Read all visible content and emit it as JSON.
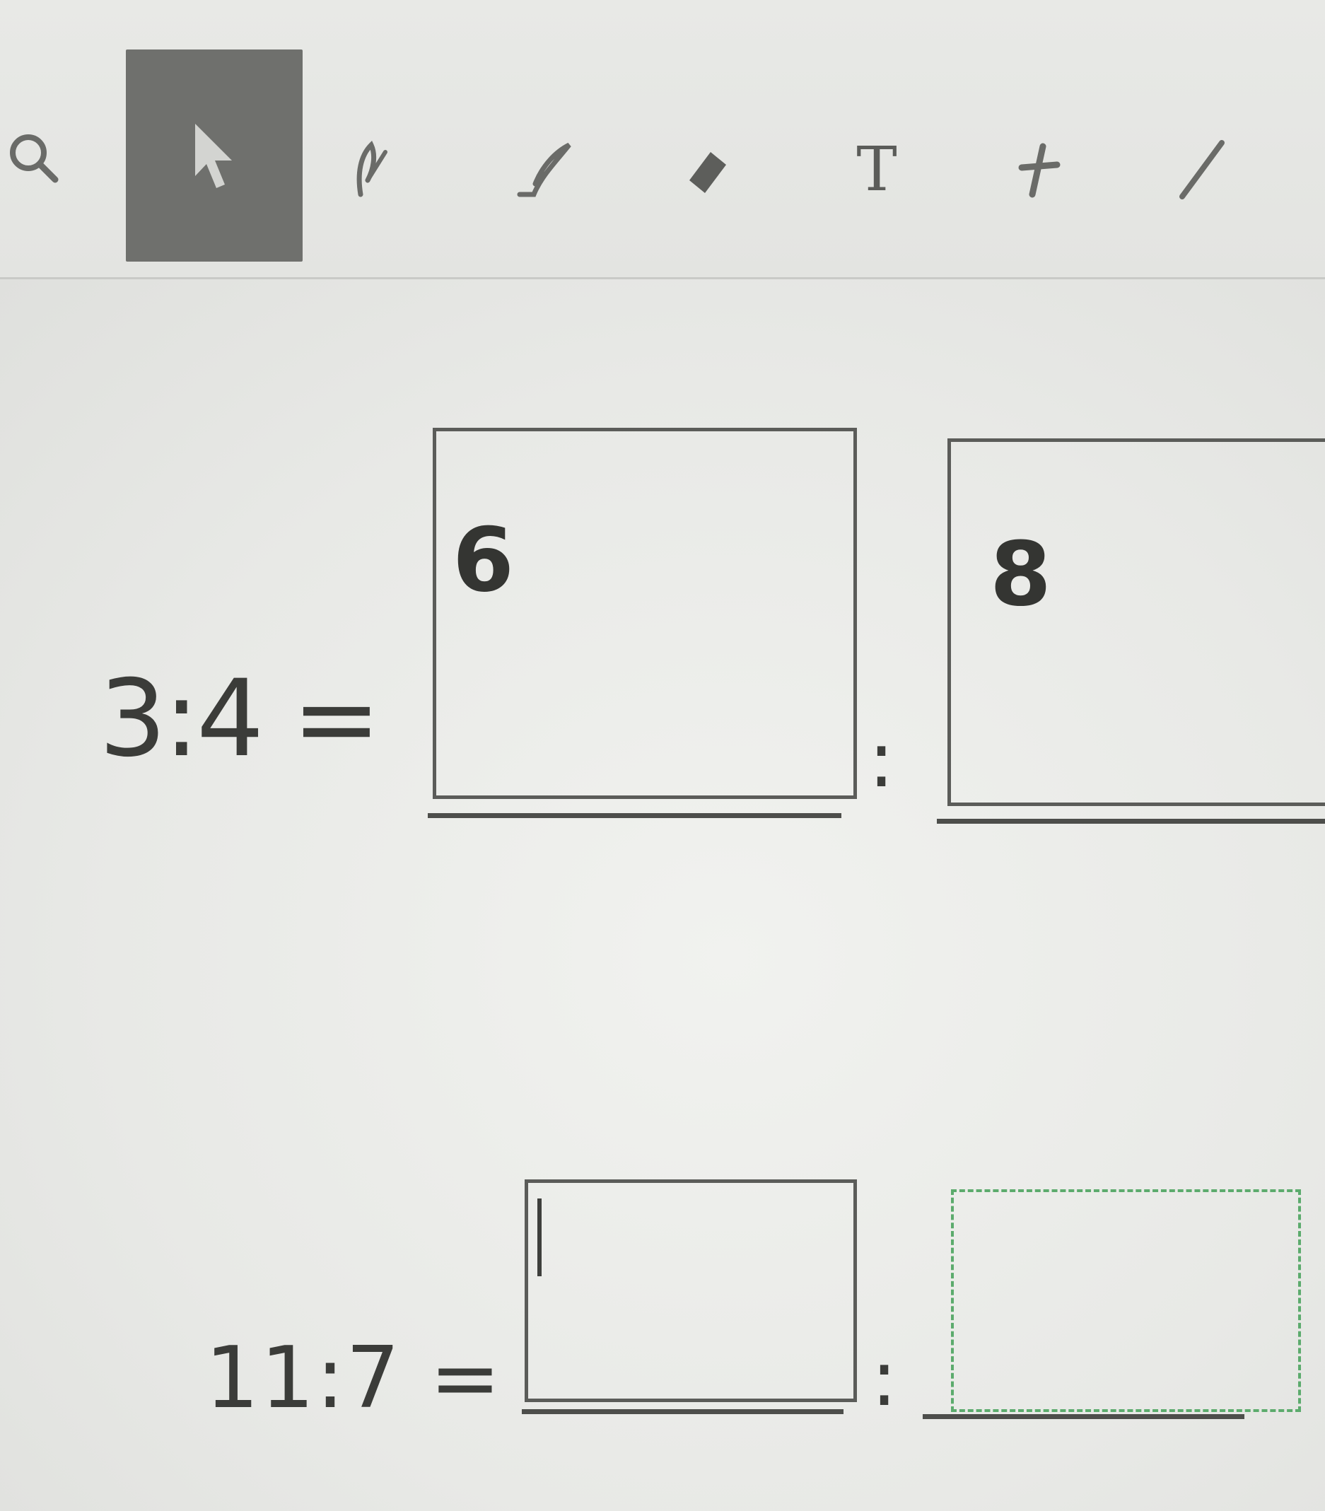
{
  "toolbar": {
    "tools": [
      {
        "name": "zoom",
        "icon": "zoom-icon"
      },
      {
        "name": "select",
        "icon": "pointer-icon",
        "active": true
      },
      {
        "name": "pen",
        "icon": "pen-icon"
      },
      {
        "name": "brush",
        "icon": "brush-icon"
      },
      {
        "name": "eraser",
        "icon": "eraser-icon"
      },
      {
        "name": "text",
        "icon": "text-icon",
        "label": "T"
      },
      {
        "name": "pin",
        "icon": "pin-icon"
      },
      {
        "name": "line",
        "icon": "line-icon"
      }
    ],
    "active_color": "#6f706d"
  },
  "exercise1": {
    "prompt": "3:4 =",
    "answer1": "6",
    "separator": ":",
    "answer2": "8"
  },
  "exercise2": {
    "prompt": "11:7 =",
    "answer1": "",
    "separator": ":",
    "answer2": ""
  },
  "colors": {
    "dashed_box": "#5cab6d",
    "box_border": "#5b5c59"
  }
}
